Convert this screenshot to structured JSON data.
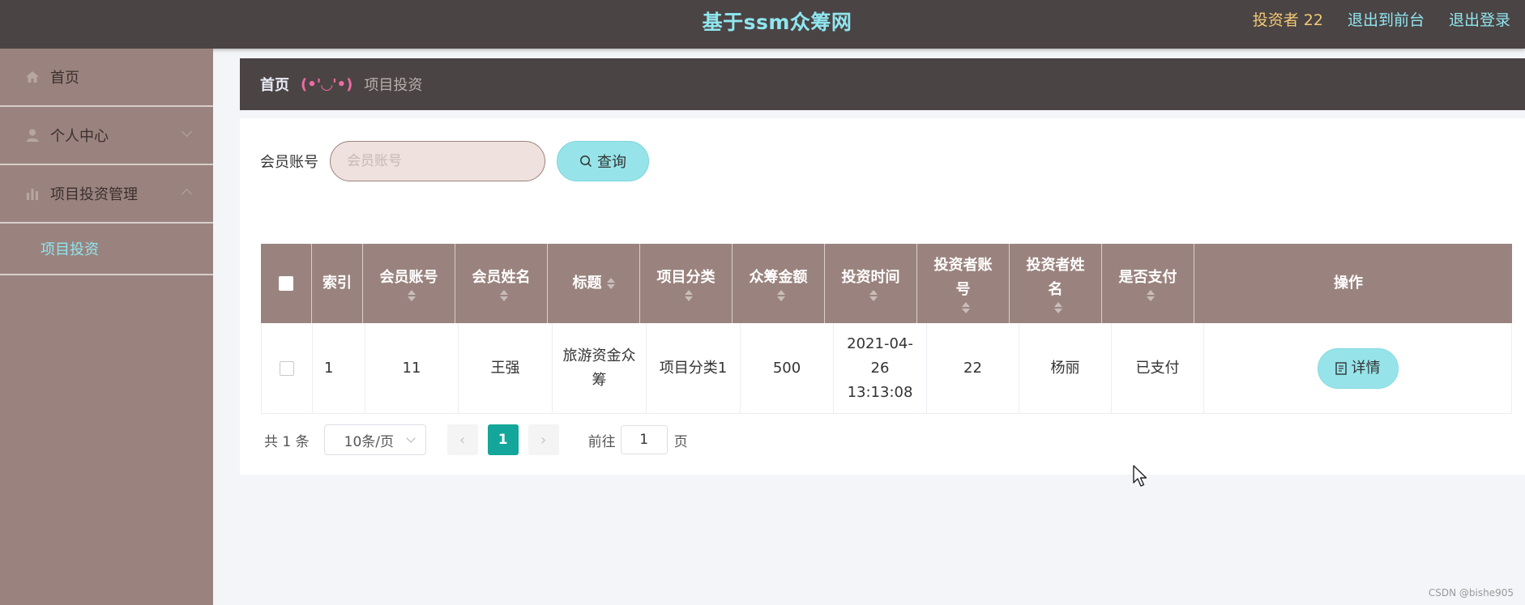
{
  "header": {
    "title": "基于ssm众筹网",
    "user": "投资者 22",
    "links": [
      "退出到前台",
      "退出登录"
    ]
  },
  "sidebar": {
    "items": [
      {
        "label": "首页",
        "icon": "home-icon"
      },
      {
        "label": "个人中心",
        "icon": "user-icon"
      },
      {
        "label": "项目投资管理",
        "icon": "chart-icon"
      }
    ],
    "subitems": [
      {
        "label": "项目投资"
      }
    ]
  },
  "breadcrumb": {
    "home": "首页",
    "face": "(•'◡'•)",
    "current": "项目投资"
  },
  "search": {
    "label": "会员账号",
    "placeholder": "会员账号",
    "button": "查询"
  },
  "table": {
    "headers": [
      "索引",
      "会员账号",
      "会员姓名",
      "标题",
      "项目分类",
      "众筹金额",
      "投资时间",
      "投资者账号",
      "投资者姓名",
      "是否支付",
      "操作"
    ],
    "rows": [
      {
        "index": "1",
        "member_account": "11",
        "member_name": "王强",
        "title": "旅游资金众筹",
        "category": "项目分类1",
        "amount": "500",
        "time": "2021-04-26 13:13:08",
        "investor_account": "22",
        "investor_name": "杨丽",
        "paid": "已支付",
        "action": "详情"
      }
    ]
  },
  "pagination": {
    "total": "共 1 条",
    "page_size": "10条/页",
    "current_page": "1",
    "goto_label": "前往",
    "goto_value": "1",
    "page_suffix": "页"
  },
  "watermark": "CSDN @bishe905",
  "colors": {
    "topbar": "#4b4444",
    "sidebar": "#9a837e",
    "accent_cyan": "#8fe6ef",
    "button": "#96e4ea",
    "pager_active": "#14a69a"
  }
}
